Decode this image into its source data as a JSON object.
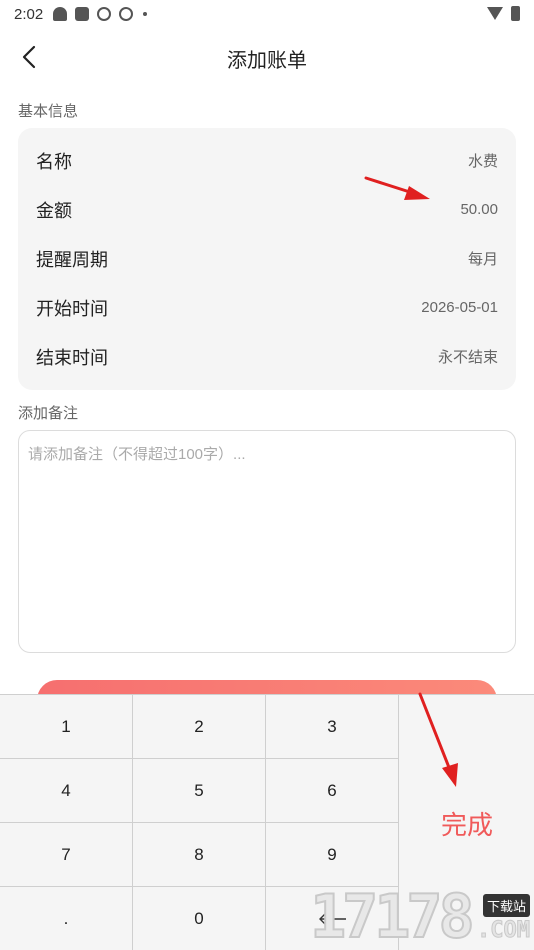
{
  "status_bar": {
    "time": "2:02"
  },
  "header": {
    "title": "添加账单"
  },
  "basic_info": {
    "section_label": "基本信息",
    "rows": [
      {
        "label": "名称",
        "value": "水费"
      },
      {
        "label": "金额",
        "value": "50.00"
      },
      {
        "label": "提醒周期",
        "value": "每月"
      },
      {
        "label": "开始时间",
        "value": "2026-05-01"
      },
      {
        "label": "结束时间",
        "value": "永不结束"
      }
    ]
  },
  "note": {
    "section_label": "添加备注",
    "placeholder": "请添加备注（不得超过100字）...",
    "value": ""
  },
  "keypad": {
    "keys": [
      "1",
      "2",
      "3",
      "4",
      "5",
      "6",
      "7",
      "8",
      "9",
      ".",
      "0"
    ],
    "done_label": "完成"
  },
  "watermark": {
    "number": "17178",
    "badge": "下载站",
    "domain": ".COM"
  },
  "colors": {
    "accent": "#f05a5a",
    "annotation_arrow": "#e02020",
    "card_bg": "#f5f5f5"
  }
}
